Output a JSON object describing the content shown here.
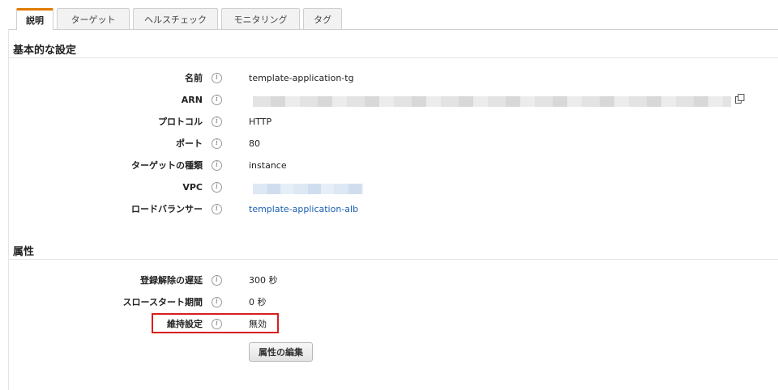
{
  "tabs": [
    {
      "label": "説明",
      "active": true
    },
    {
      "label": "ターゲット",
      "active": false
    },
    {
      "label": "ヘルスチェック",
      "active": false
    },
    {
      "label": "モニタリング",
      "active": false
    },
    {
      "label": "タグ",
      "active": false
    }
  ],
  "basic": {
    "title": "基本的な設定",
    "name_label": "名前",
    "name_value": "template-application-tg",
    "arn_label": "ARN",
    "protocol_label": "プロトコル",
    "protocol_value": "HTTP",
    "port_label": "ポート",
    "port_value": "80",
    "target_type_label": "ターゲットの種類",
    "target_type_value": "instance",
    "vpc_label": "VPC",
    "lb_label": "ロードバランサー",
    "lb_value": "template-application-alb"
  },
  "attributes": {
    "title": "属性",
    "dereg_label": "登録解除の遅延",
    "dereg_value": "300 秒",
    "slow_start_label": "スロースタート期間",
    "slow_start_value": "0 秒",
    "stickiness_label": "維持設定",
    "stickiness_value": "無効",
    "edit_button_label": "属性の編集"
  },
  "info_glyph": "i",
  "icons": {
    "info": "info-circle-icon",
    "copy": "copy-icon"
  },
  "colors": {
    "active_tab_accent": "#e07b00",
    "link": "#1a5fb4",
    "highlight": "#d81e1e"
  }
}
